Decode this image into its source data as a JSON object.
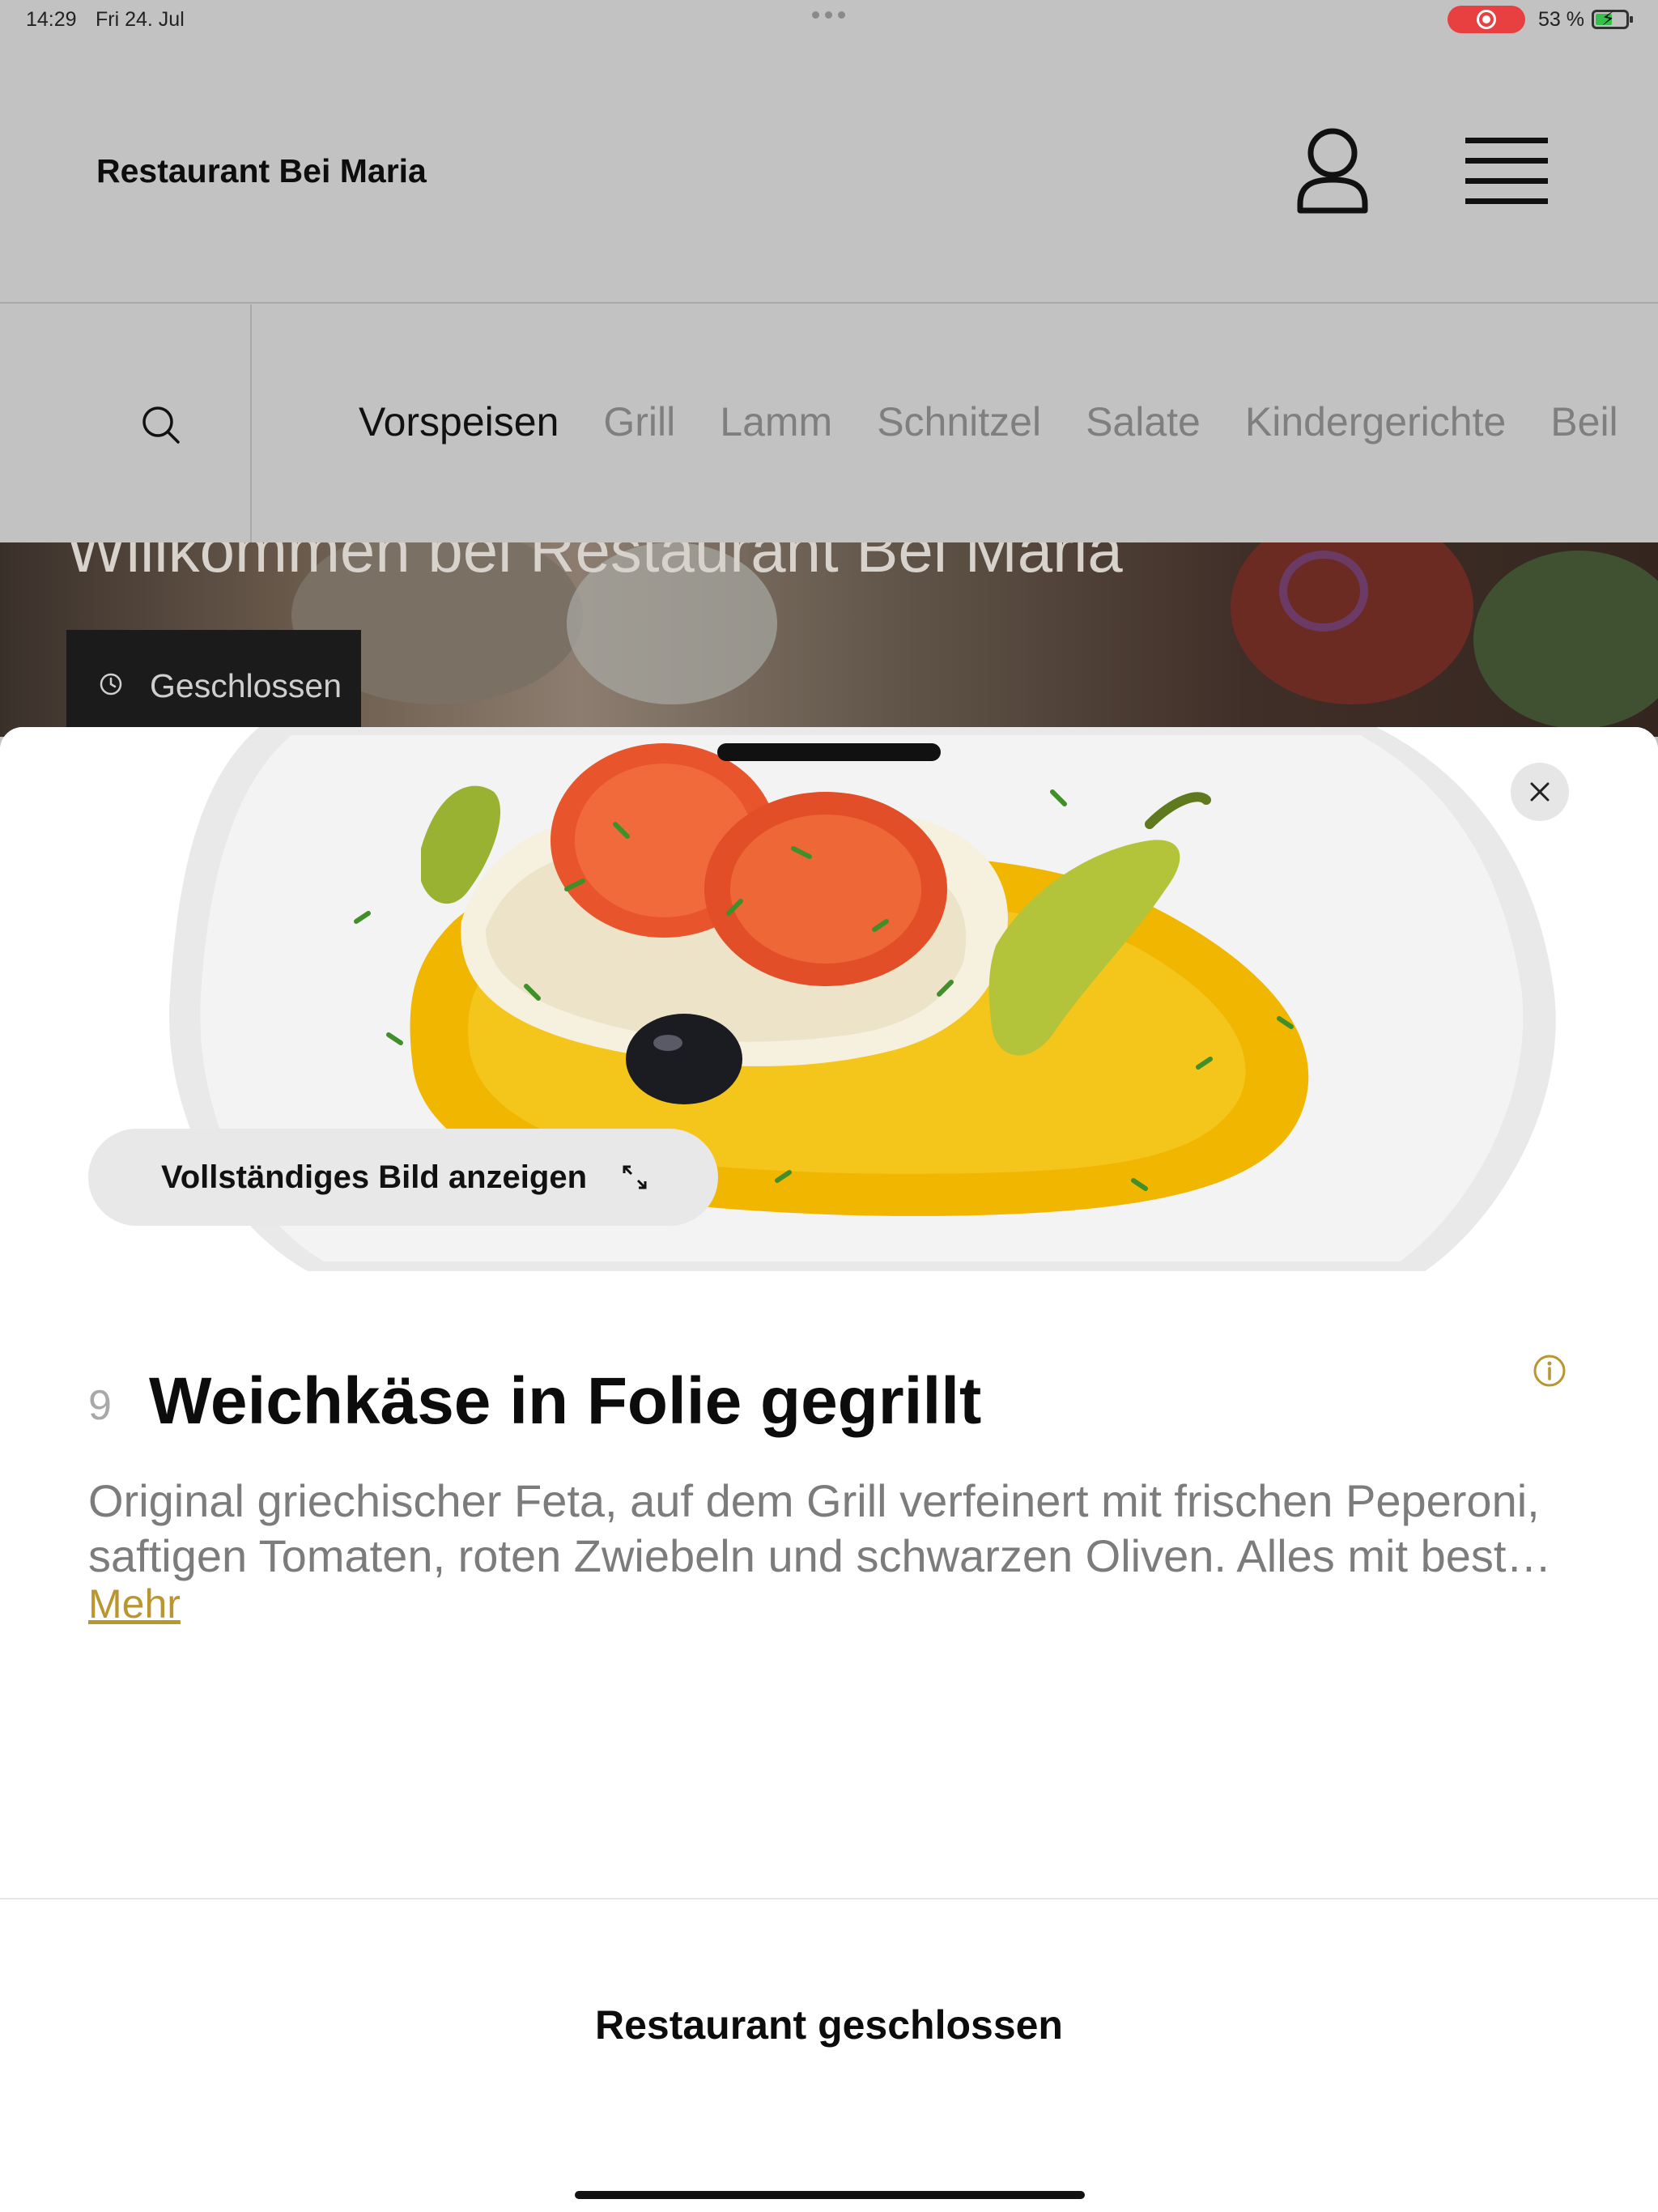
{
  "status_bar": {
    "time": "14:29",
    "date": "Fri 24. Jul",
    "battery": "53 %",
    "recording_color": "#e84040"
  },
  "header": {
    "restaurant_name": "Restaurant Bei Maria",
    "account_icon": "user-icon",
    "menu_icon": "hamburger-menu-icon"
  },
  "category_nav": {
    "search_icon": "search-icon",
    "tabs": [
      {
        "label": "Vorspeisen",
        "active": true
      },
      {
        "label": "Grill",
        "active": false
      },
      {
        "label": "Lamm",
        "active": false
      },
      {
        "label": "Schnitzel",
        "active": false
      },
      {
        "label": "Salate",
        "active": false
      },
      {
        "label": "Kindergerichte",
        "active": false
      },
      {
        "label": "Beil",
        "active": false
      }
    ]
  },
  "hero": {
    "title": "Willkommen bei Restaurant Bei Maria",
    "status": "Geschlossen"
  },
  "sheet": {
    "full_image_button": "Vollständiges Bild anzeigen",
    "item": {
      "number": "9",
      "title": "Weichkäse in Folie gegrillt",
      "description_line1": "Original griechischer Feta, auf dem Grill verfeinert mit frischen Peperoni,",
      "description_line2": "saftigen Tomaten, roten Zwiebeln und schwarzen Oliven. Alles mit best…",
      "more": "Mehr"
    },
    "footer": "Restaurant geschlossen"
  },
  "colors": {
    "accent": "#b9962f",
    "overlay": "#c2c2c2"
  }
}
